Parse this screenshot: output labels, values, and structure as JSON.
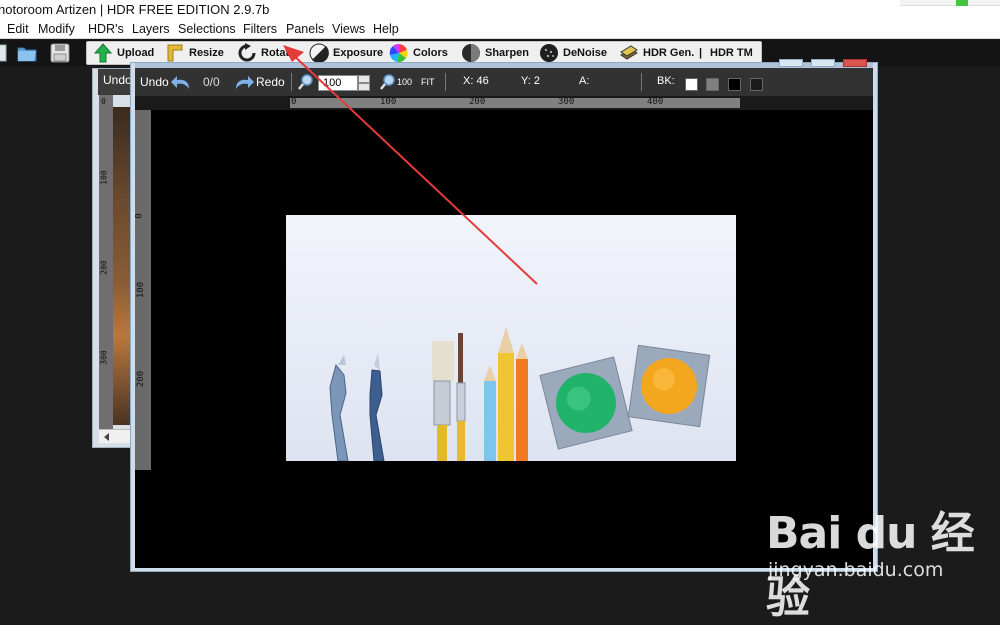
{
  "window": {
    "title": "hotoroom Artizen | HDR FREE EDITION 2.9.7b"
  },
  "menu": [
    "Edit",
    "Modify",
    "HDR's",
    "Layers",
    "Selections",
    "Filters",
    "Panels",
    "Views",
    "Help"
  ],
  "tools": {
    "upload": "Upload",
    "resize": "Resize",
    "rotate": "Rotate",
    "exposure": "Exposure",
    "colors": "Colors",
    "sharpen": "Sharpen",
    "denoise": "DeNoise",
    "hdr_gen": "HDR Gen.",
    "separator": "|",
    "hdr_tm": "HDR TM"
  },
  "back_window": {
    "undo_label": "Undo"
  },
  "doc_toolbar": {
    "undo_label": "Undo",
    "history_count": "0/0",
    "redo_label": "Redo",
    "zoom_value": "100",
    "zoom_100_label": "100",
    "zoom_fit_label": "FIT",
    "x_label": "X: 46",
    "y_label": "Y: 2",
    "a_label": "A:",
    "bk_label": "BK:",
    "bk_colors": [
      "#ffffff",
      "#7f7f7f",
      "#000000",
      "#1a1a1a"
    ]
  },
  "rulers": {
    "horizontal": [
      "0",
      "100",
      "200",
      "300",
      "400"
    ],
    "vertical": [
      "0",
      "100",
      "200"
    ],
    "back_vertical": [
      "0",
      "100",
      "200",
      "300"
    ]
  },
  "colors": {
    "accent_arrow": "#e53b3b",
    "window_border": "#8fa9c3"
  },
  "watermark": {
    "brand": "Bai du 经验",
    "url": "jingyan.baidu.com"
  }
}
